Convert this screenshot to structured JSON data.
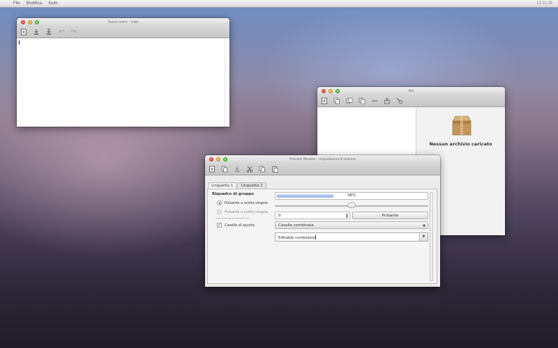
{
  "menubar": {
    "items": [
      "File",
      "Modifica",
      "Aiuto"
    ],
    "clock": "13:11:26"
  },
  "kate": {
    "title": "Senza nome – Kate",
    "toolbar": [
      "new-document-icon",
      "save-icon",
      "save-as-icon",
      "undo-icon",
      "redo-icon"
    ]
  },
  "ark": {
    "title": "Ark",
    "toolbar": [
      "new-archive-icon",
      "open-archive-icon",
      "extract-icon",
      "add-file-icon",
      "remove-icon",
      "share-icon",
      "find-icon"
    ],
    "empty_message": "Nessun archivio caricato"
  },
  "preview": {
    "title": "Preview Window – Impostazioni di sistema",
    "toolbar": [
      "new-icon",
      "open-icon",
      "save-icon",
      "cut-icon",
      "copy-icon",
      "paste-icon"
    ],
    "tabs": [
      "Linguetta 1",
      "Linguetta 2"
    ],
    "group_title": "Riquadro di gruppo",
    "radio1": "Pulsante a scelta singola",
    "radio2": "Pulsante a scelta singola",
    "checkbox": "Casella di spunta",
    "progress": {
      "value": 38,
      "label": "38%"
    },
    "slider": {
      "value": 0.5
    },
    "spinbox": "0",
    "button": "Pulsante",
    "combo": "Casella combinata",
    "editable_combo": "Editable combobox"
  },
  "colors": {
    "desktop_top": "#6d8dc2",
    "desktop_bottom": "#221c29",
    "progress_fill": "#8fb2e5"
  }
}
